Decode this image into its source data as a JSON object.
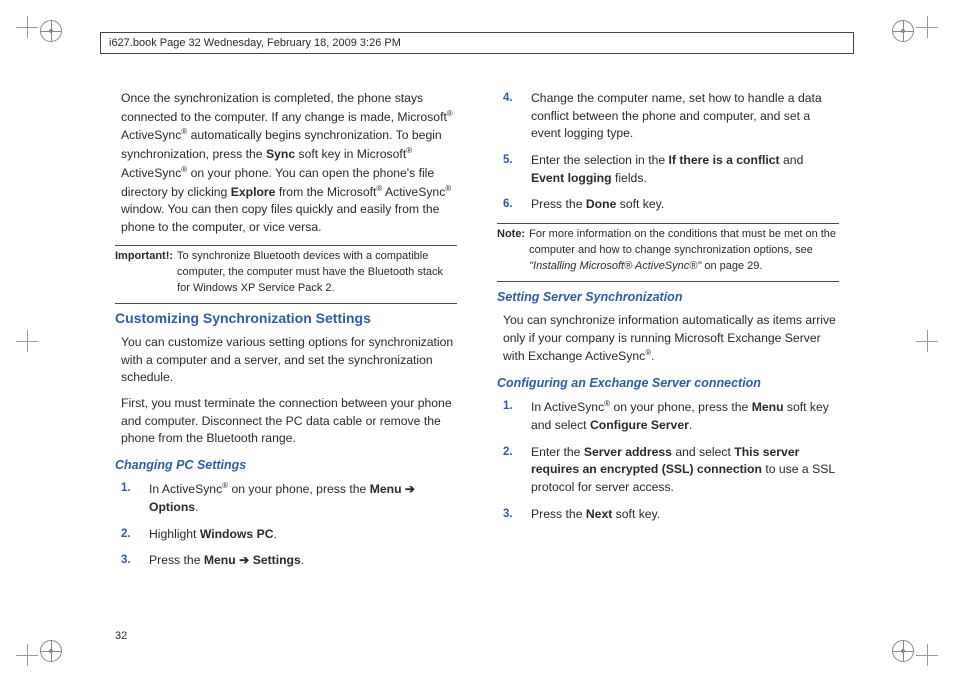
{
  "header_line": "i627.book  Page 32  Wednesday, February 18, 2009  3:26 PM",
  "page_number": "32",
  "left": {
    "intro": {
      "p1a": "Once the synchronization is completed, the phone stays connected to the computer. If any change is made, Microsoft",
      "p1b": " ActiveSync",
      "p1c": " automatically begins synchronization. To begin synchronization, press the ",
      "sync": "Sync",
      "p1d": " soft key in Microsoft",
      "p1e": " ActiveSync",
      "p1f": " on your phone. You can open the phone's file directory by clicking ",
      "explore": "Explore",
      "p1g": " from the Microsoft",
      "p1h": " ActiveSync",
      "p1i": " window. You can then copy files quickly and easily from the phone to the computer, or vice versa."
    },
    "important_label": "Important!:",
    "important_text": "To synchronize Bluetooth devices with a compatible computer, the computer must have the Bluetooth stack for Windows XP Service Pack 2.",
    "h2": "Customizing Synchronization Settings",
    "cust_p1": "You can customize various setting options for synchronization with a computer and a server, and set the synchronization schedule.",
    "cust_p2": "First, you must terminate the connection between your phone and computer. Disconnect the PC data cable or remove the phone from the Bluetooth range.",
    "h3": "Changing PC Settings",
    "steps": {
      "s1": {
        "num": "1.",
        "a": "In ActiveSync",
        "b": " on your phone, press the ",
        "menu": "Menu",
        "arrow": " ➔ ",
        "options": "Options",
        "end": "."
      },
      "s2": {
        "num": "2.",
        "a": "Highlight ",
        "b": "Windows PC",
        "end": "."
      },
      "s3": {
        "num": "3.",
        "a": "Press the ",
        "menu": "Menu",
        "arrow": " ➔ ",
        "settings": "Settings",
        "end": "."
      }
    }
  },
  "right": {
    "steps_top": {
      "s4": {
        "num": "4.",
        "text": "Change the computer name, set how to handle a data conflict between the phone and computer, and set a event logging type."
      },
      "s5": {
        "num": "5.",
        "a": "Enter the selection in the ",
        "b": "If there is a conflict",
        "c": " and ",
        "d": "Event logging",
        "e": " fields."
      },
      "s6": {
        "num": "6.",
        "a": "Press the ",
        "b": "Done",
        "c": " soft key."
      }
    },
    "note_label": "Note:",
    "note_a": "For more information on the conditions that must be met on the computer and how to change synchronization options, see ",
    "note_ital": "\"Installing Microsoft® ActiveSync®\"",
    "note_b": " on page 29.",
    "h3a": "Setting Server Synchronization",
    "srv_p": {
      "a": "You can synchronize information automatically as items arrive only if your company is running Microsoft Exchange Server with Exchange ActiveSync",
      "b": "."
    },
    "h3b": "Configuring an Exchange Server connection",
    "steps_bot": {
      "s1": {
        "num": "1.",
        "a": "In ActiveSync",
        "b": " on your phone, press the ",
        "menu": "Menu",
        "c": " soft key and select ",
        "cs": "Configure Server",
        "end": "."
      },
      "s2": {
        "num": "2.",
        "a": "Enter the ",
        "sa": "Server address",
        "b": " and select ",
        "ssl": "This server requires an encrypted (SSL) connection",
        "c": " to use a SSL protocol for server access."
      },
      "s3": {
        "num": "3.",
        "a": "Press the ",
        "next": "Next",
        "b": " soft key."
      }
    }
  }
}
